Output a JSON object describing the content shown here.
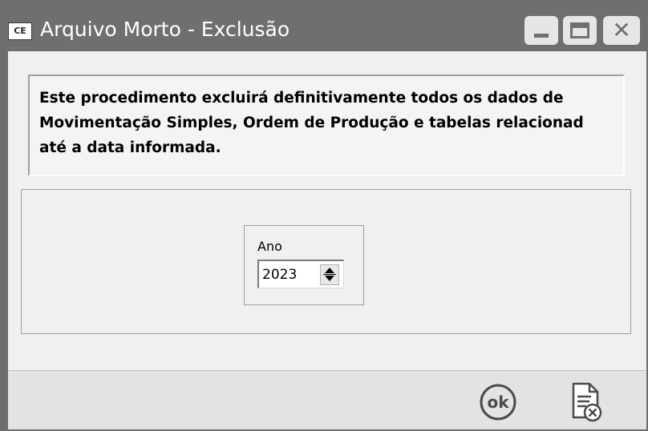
{
  "window": {
    "title": "Arquivo Morto - Exclusão",
    "app_icon_text": "CE",
    "buttons": [
      "minimize",
      "maximize",
      "close"
    ]
  },
  "message": {
    "lines": [
      "Este procedimento excluirá definitivamente todos os dados de",
      "Movimentação Simples, Ordem de Produção e tabelas relacionad",
      "até a data informada."
    ]
  },
  "year_field": {
    "label": "Ano",
    "value": "2023"
  },
  "footer": {
    "ok_icon": "ok-icon",
    "ok_text": "ok",
    "cancel_icon": "cancel-document-icon"
  },
  "colors": {
    "titlebar": "#6f6f6f",
    "window_bg": "#f0f0f0",
    "footer_bg": "#e3e3e3"
  }
}
